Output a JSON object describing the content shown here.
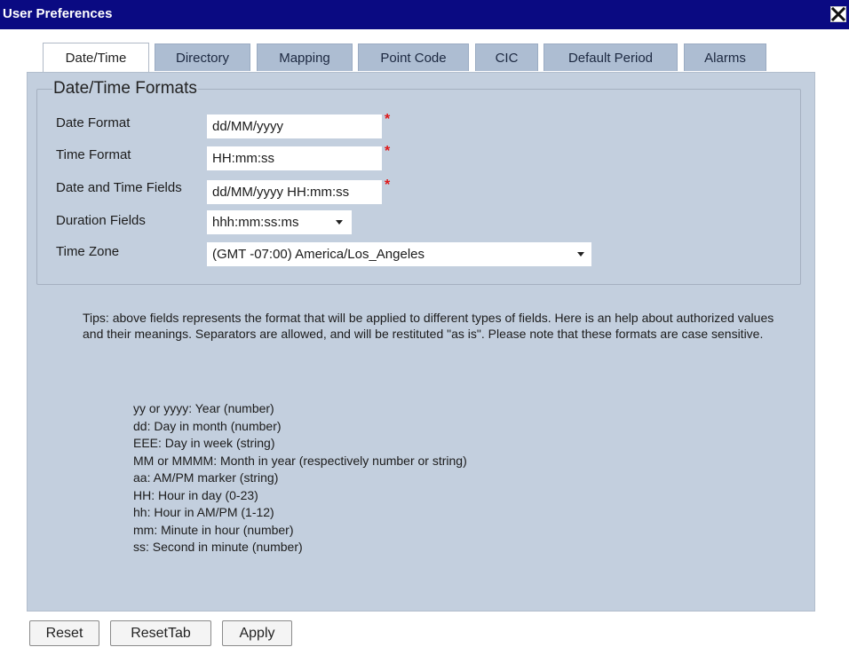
{
  "window": {
    "title": "User Preferences",
    "close_icon": "close-icon"
  },
  "tabs": [
    {
      "label": "Date/Time",
      "active": true
    },
    {
      "label": "Directory"
    },
    {
      "label": "Mapping"
    },
    {
      "label": "Point Code"
    },
    {
      "label": "CIC"
    },
    {
      "label": "Default Period"
    },
    {
      "label": "Alarms"
    }
  ],
  "section": {
    "legend": "Date/Time Formats",
    "fields": {
      "date_format": {
        "label": "Date Format",
        "value": "dd/MM/yyyy",
        "required": true
      },
      "time_format": {
        "label": "Time Format",
        "value": "HH:mm:ss",
        "required": true
      },
      "date_time_fields": {
        "label": "Date and Time Fields",
        "value": "dd/MM/yyyy HH:mm:ss",
        "required": true
      },
      "duration_fields": {
        "label": "Duration Fields",
        "value": "hhh:mm:ss:ms"
      },
      "time_zone": {
        "label": "Time Zone",
        "value": "(GMT -07:00) America/Los_Angeles"
      }
    },
    "required_marker": "*"
  },
  "tips": "Tips: above fields represents the format that will be applied to different types of fields. Here is an help about authorized values and their meanings. Separators are allowed, and will be restituted \"as is\". Please note that these formats are case sensitive.",
  "help_lines": [
    "yy or yyyy: Year (number)",
    "dd: Day in month (number)",
    "EEE: Day in week (string)",
    "MM or MMMM: Month in year (respectively number or string)",
    "aa: AM/PM marker (string)",
    "HH: Hour in day (0-23)",
    "hh: Hour in AM/PM (1-12)",
    "mm: Minute in hour (number)",
    "ss: Second in minute (number)"
  ],
  "buttons": {
    "reset": "Reset",
    "reset_tab": "ResetTab",
    "apply": "Apply"
  },
  "colors": {
    "titlebar": "#0a0a82",
    "panel": "#c3cfde",
    "tab": "#adbdd2",
    "required": "#e01818"
  }
}
